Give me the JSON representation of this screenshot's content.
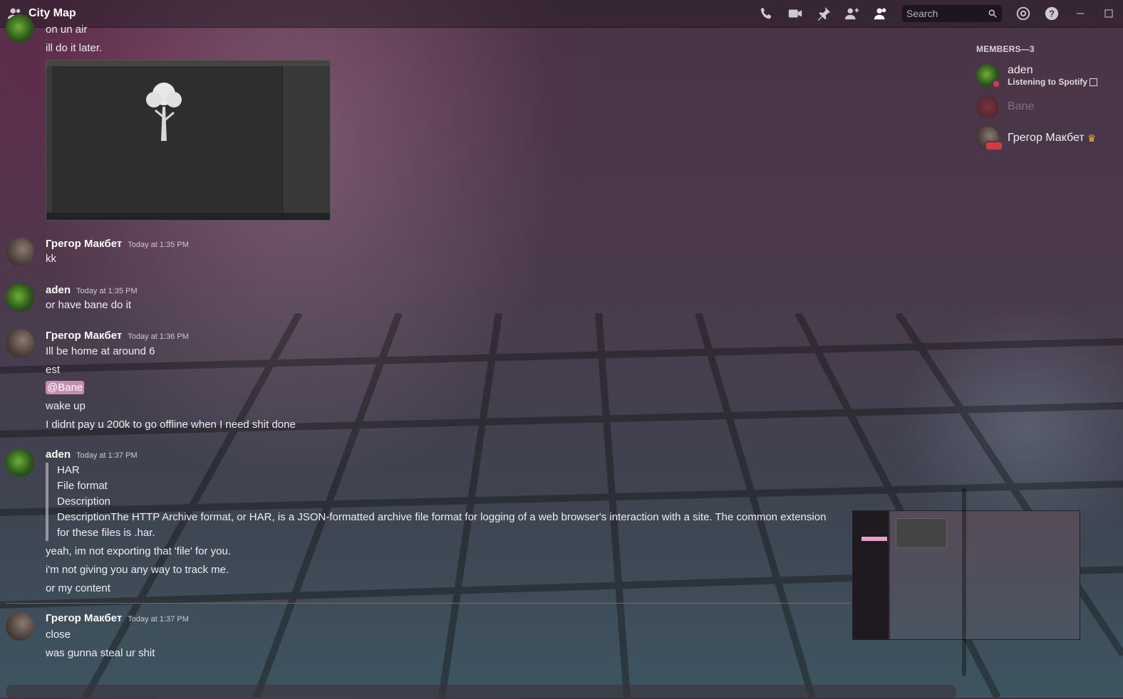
{
  "window": {
    "title": "City Map"
  },
  "toolbar": {
    "search_placeholder": "Search"
  },
  "members": {
    "header": "MEMBERS—3",
    "list": [
      {
        "name": "aden",
        "activity_prefix": "Listening to ",
        "activity_app": "Spotify"
      },
      {
        "name": "Bane"
      },
      {
        "name": "Грегор Макбет",
        "crown": "♛"
      }
    ]
  },
  "messages": {
    "pre": [
      "on un air",
      "ill do it later."
    ],
    "m1": {
      "author": "Грегор Макбет",
      "time": "Today at 1:35 PM",
      "lines": [
        "kk"
      ]
    },
    "m2": {
      "author": "aden",
      "time": "Today at 1:35 PM",
      "lines": [
        "or have bane do it"
      ]
    },
    "m3": {
      "author": "Грегор Макбет",
      "time": "Today at 1:36 PM",
      "lines": [
        "Ill be home at around 6",
        "est",
        "@Bane",
        "wake up",
        "I didnt pay u 200k to go offline when I need shit done"
      ]
    },
    "m4": {
      "author": "aden",
      "time": "Today at 1:37 PM",
      "quote": [
        "HAR",
        "File format",
        "Description",
        "DescriptionThe HTTP Archive format, or HAR, is a JSON-formatted archive file format for logging of a web browser's interaction with a site. The common extension for these files is .har."
      ],
      "lines": [
        "yeah, im not exporting that 'file' for you.",
        "i'm not giving you any way to track me.",
        "or my content"
      ]
    },
    "m5": {
      "author": "Грегор Макбет",
      "time": "Today at 1:37 PM",
      "lines": [
        "close",
        "was gunna steal ur shit"
      ]
    }
  },
  "colors": {
    "mention_bg": "#f0aad2",
    "new_divider": "#c9405a",
    "crown": "#f0b232"
  }
}
